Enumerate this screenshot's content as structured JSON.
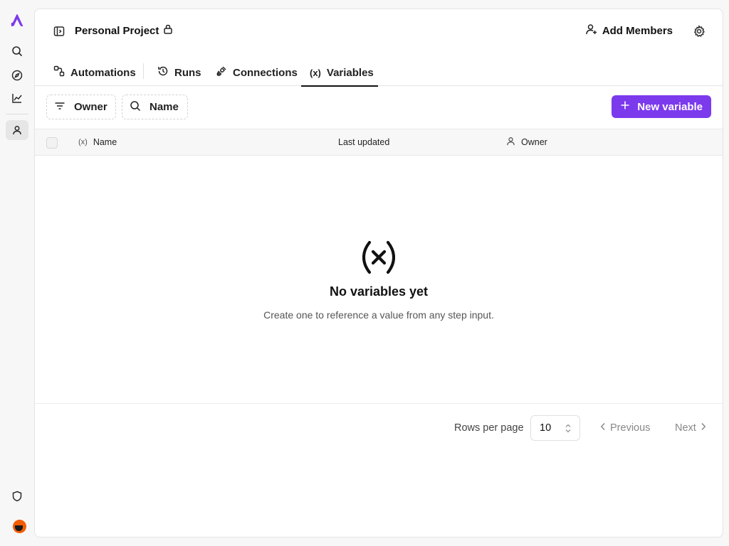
{
  "rail": {
    "items": [
      {
        "icon": "logo-icon"
      },
      {
        "icon": "search-icon"
      },
      {
        "icon": "compass-icon"
      },
      {
        "icon": "chart-icon"
      },
      {
        "icon": "user-icon",
        "active": true
      },
      {
        "icon": "shield-icon"
      },
      {
        "icon": "avatar"
      }
    ]
  },
  "header": {
    "project_title": "Personal Project",
    "add_members_label": "Add Members"
  },
  "tabs": [
    {
      "label": "Automations",
      "icon": "automations-icon"
    },
    {
      "label": "Runs",
      "icon": "history-icon"
    },
    {
      "label": "Connections",
      "icon": "plug-icon"
    },
    {
      "label": "Variables",
      "icon": "variable-icon",
      "active": true
    }
  ],
  "toolbar": {
    "owner_filter_label": "Owner",
    "name_filter_label": "Name",
    "new_variable_label": "New variable"
  },
  "table": {
    "columns": [
      "Name",
      "Last updated",
      "Owner"
    ]
  },
  "empty_state": {
    "title": "No variables yet",
    "description": "Create one to reference a value from any step input."
  },
  "pagination": {
    "rows_per_page_label": "Rows per page",
    "rows_per_page_value": "10",
    "previous_label": "Previous",
    "next_label": "Next"
  },
  "colors": {
    "accent": "#7c3aed",
    "logo": "#7c3aed",
    "avatar": "#f25c05"
  }
}
